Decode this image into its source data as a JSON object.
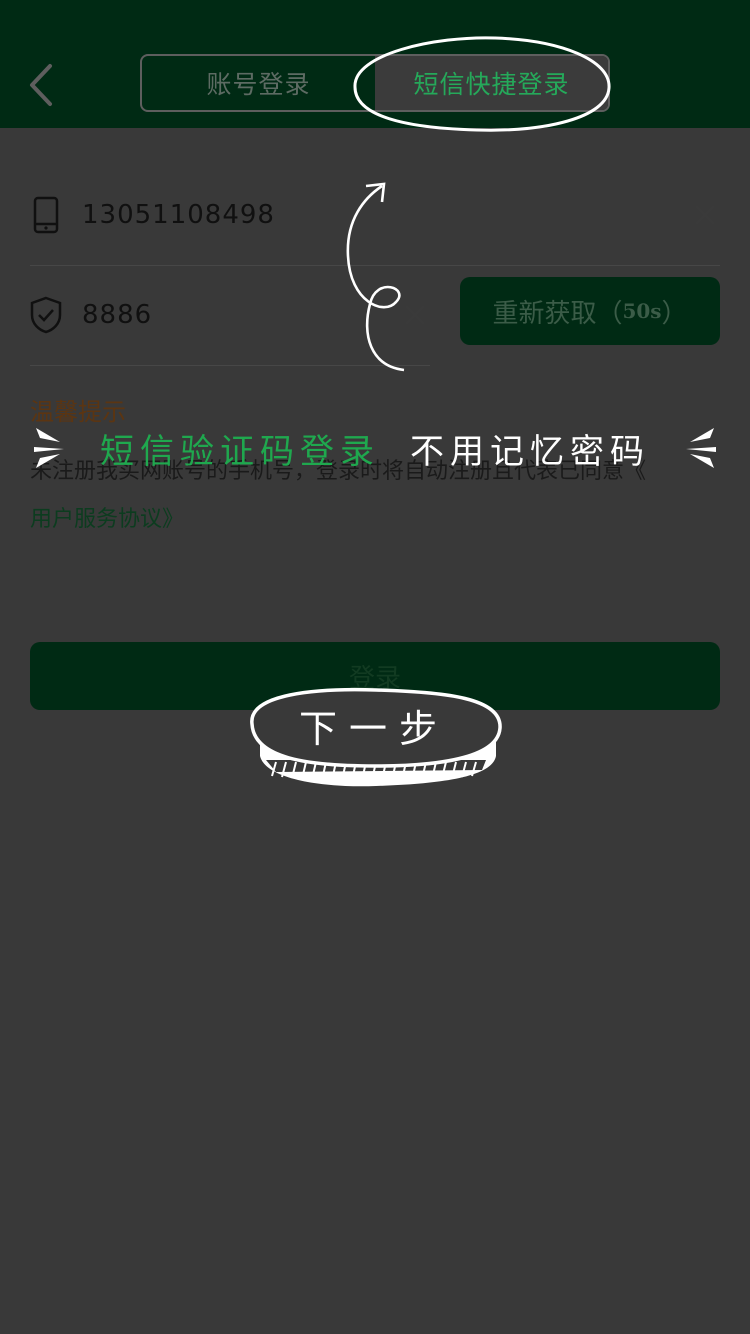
{
  "header": {
    "tabs": [
      {
        "label": "账号登录",
        "active": false
      },
      {
        "label": "短信快捷登录",
        "active": true
      }
    ]
  },
  "form": {
    "phone_value": "13051108498",
    "code_value": "8886",
    "resend_label": "重新获取（",
    "resend_seconds": "50s",
    "resend_suffix": "）"
  },
  "tips": {
    "title": "温馨提示",
    "text": "未注册我买网账号的手机号，登录时将自动注册且代表已同意《",
    "link": "用户服务协议》"
  },
  "login_label": "登录",
  "annotations": {
    "banner_green": "短信验证码登录",
    "banner_white": "不用记忆密码",
    "next_step": "下一步"
  },
  "colors": {
    "accent": "#25a95a",
    "header_bg": "#002a14",
    "page_bg": "#393939"
  }
}
